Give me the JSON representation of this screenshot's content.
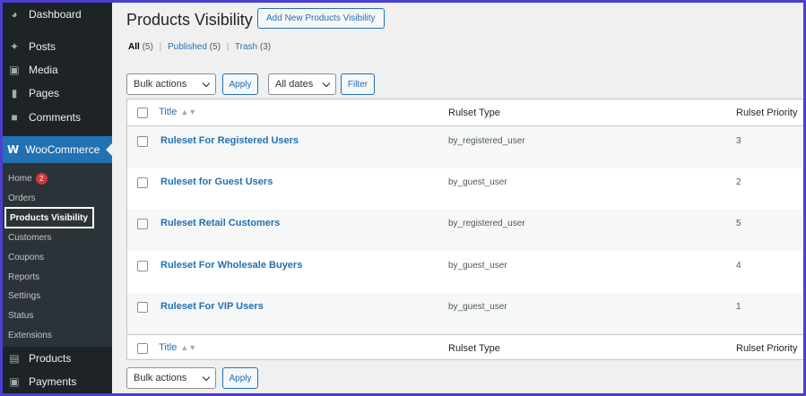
{
  "sidebar": {
    "menu": [
      {
        "label": "Dashboard",
        "icon": "dashboard-icon"
      },
      {
        "label": "Posts",
        "icon": "pin-icon"
      },
      {
        "label": "Media",
        "icon": "media-icon"
      },
      {
        "label": "Pages",
        "icon": "page-icon"
      },
      {
        "label": "Comments",
        "icon": "comment-icon"
      }
    ],
    "woocommerce": {
      "label": "WooCommerce",
      "logo": "W"
    },
    "submenu": [
      {
        "label": "Home",
        "badge": "2"
      },
      {
        "label": "Orders"
      },
      {
        "label": "Products Visibility",
        "current": true
      },
      {
        "label": "Customers"
      },
      {
        "label": "Coupons"
      },
      {
        "label": "Reports"
      },
      {
        "label": "Settings"
      },
      {
        "label": "Status"
      },
      {
        "label": "Extensions"
      }
    ],
    "menu_bottom": [
      {
        "label": "Products",
        "icon": "archive-icon"
      },
      {
        "label": "Payments",
        "icon": "dollar-icon"
      }
    ]
  },
  "header": {
    "title": "Products Visibility",
    "add_button": "Add New Products Visibility"
  },
  "filters": {
    "all": "All",
    "all_count": "(5)",
    "published": "Published",
    "published_count": "(5)",
    "trash": "Trash",
    "trash_count": "(3)",
    "sep": "|"
  },
  "toolbar": {
    "bulk_actions": "Bulk actions",
    "apply": "Apply",
    "dates": "All dates",
    "filter": "Filter"
  },
  "table": {
    "columns": {
      "title": "Title",
      "type": "Rulset Type",
      "priority": "Rulset Priority"
    },
    "rows": [
      {
        "title": "Ruleset For Registered Users",
        "type": "by_registered_user",
        "priority": "3"
      },
      {
        "title": "Ruleset for Guest Users",
        "type": "by_guest_user",
        "priority": "2"
      },
      {
        "title": "Ruleset Retail Customers",
        "type": "by_registered_user",
        "priority": "5"
      },
      {
        "title": "Ruleset For Wholesale Buyers",
        "type": "by_guest_user",
        "priority": "4"
      },
      {
        "title": "Ruleset For VIP Users",
        "type": "by_guest_user",
        "priority": "1"
      }
    ]
  },
  "colors": {
    "accent": "#2271b1",
    "sidebar": "#1d2327",
    "border": "#4a3fd0"
  }
}
